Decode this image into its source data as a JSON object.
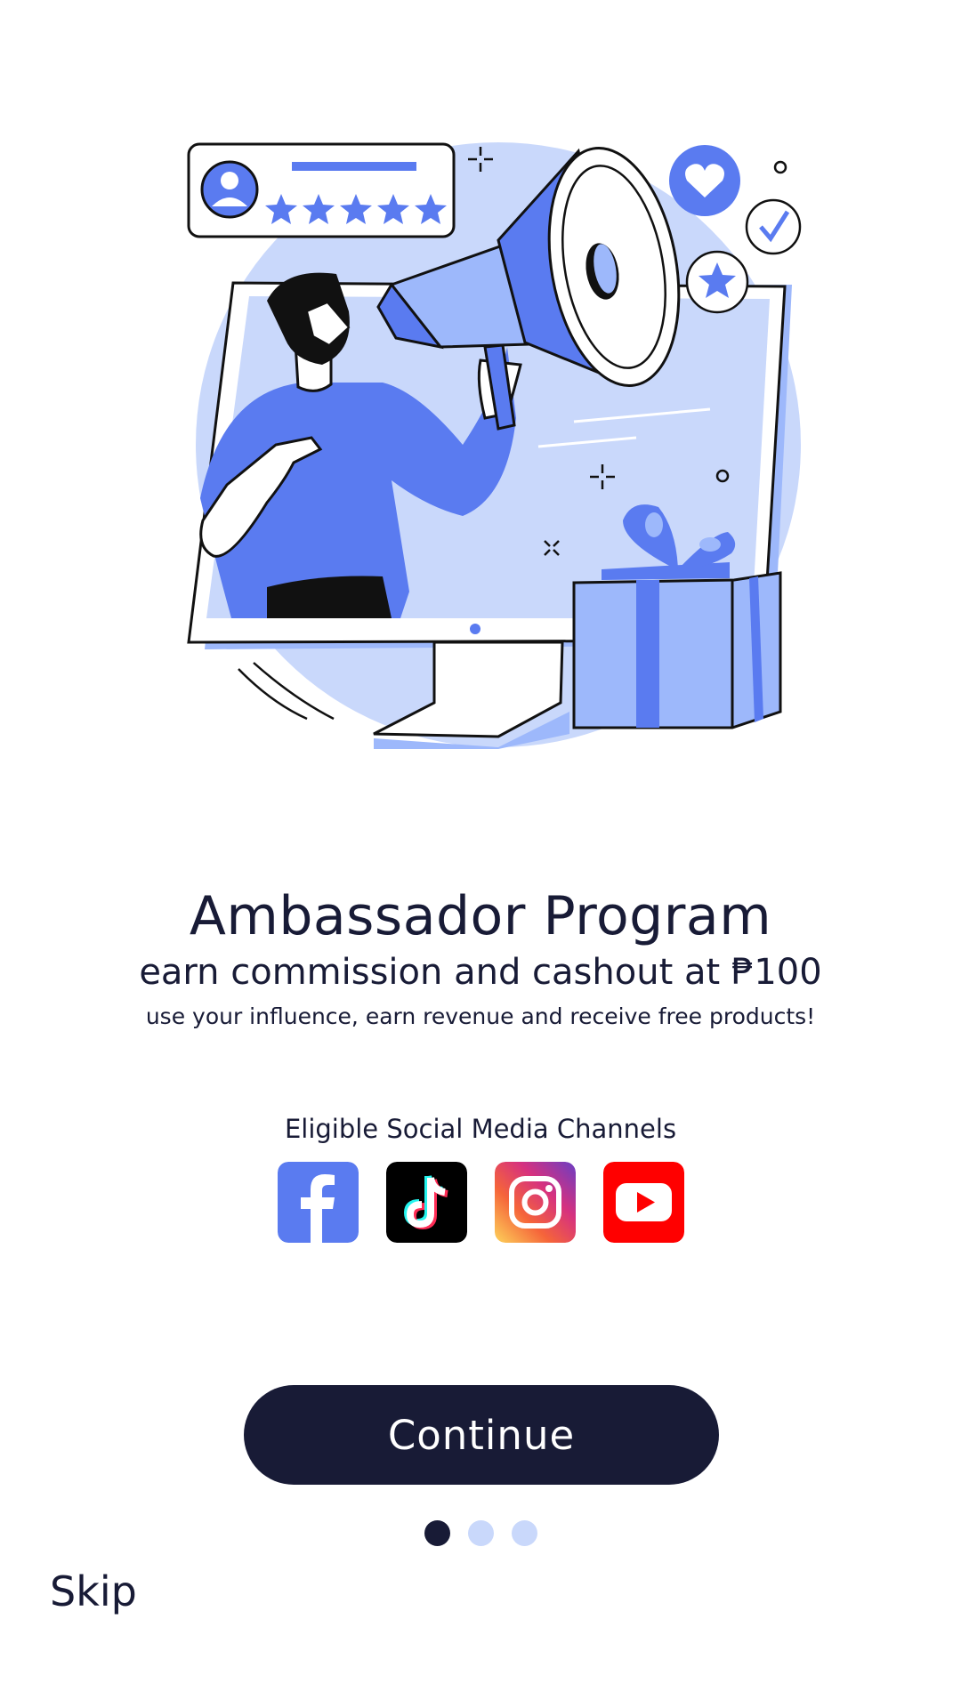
{
  "onboarding": {
    "title": "Ambassador Program",
    "subtitle": "earn commission and cashout at ₱100",
    "tagline": "use your influence, earn revenue and receive free products!",
    "channels_label": "Eligible Social Media Channels",
    "channels": [
      {
        "icon": "facebook-icon",
        "color": "#5a7bf0"
      },
      {
        "icon": "tiktok-icon",
        "color": "#000000"
      },
      {
        "icon": "instagram-icon",
        "color": "#d6317f"
      },
      {
        "icon": "youtube-icon",
        "color": "#ff0000"
      }
    ],
    "continue_label": "Continue",
    "skip_label": "Skip",
    "pagination": {
      "current_page": 1,
      "total_pages": 3
    }
  },
  "colors": {
    "primary_dark": "#181b36",
    "accent_blue": "#5a7bf0",
    "light_blue": "#c9d8fb"
  }
}
